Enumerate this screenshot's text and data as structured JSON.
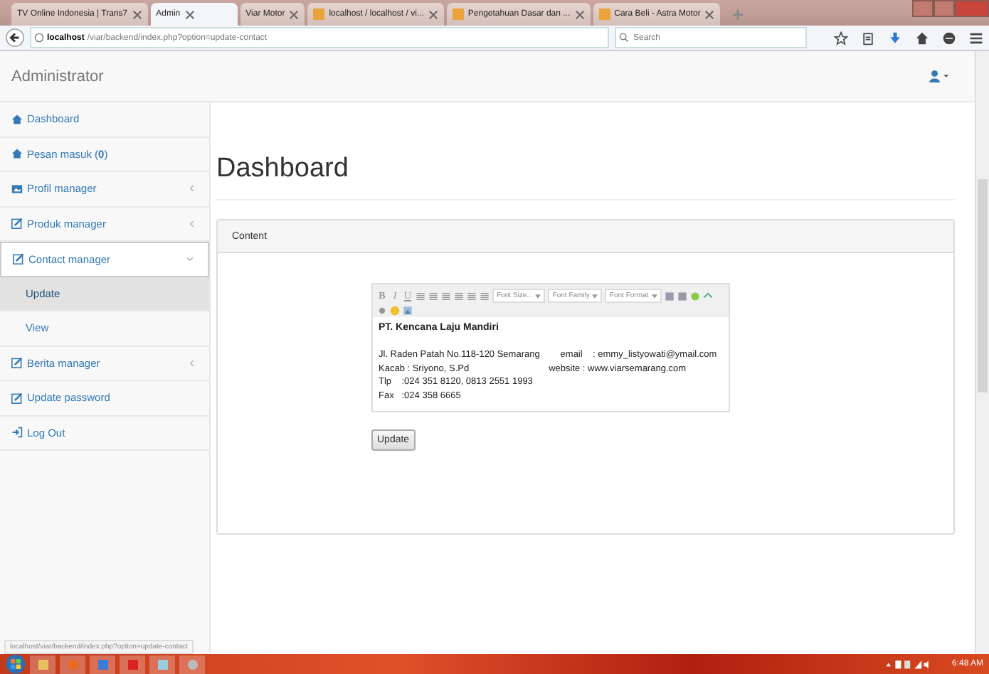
{
  "browser": {
    "tabs": [
      {
        "title": "TV Online Indonesia | Trans7",
        "selected": false,
        "favicon": false
      },
      {
        "title": "Admin",
        "selected": true,
        "favicon": false
      },
      {
        "title": "Viar Motor",
        "selected": false,
        "favicon": false
      },
      {
        "title": "localhost / localhost / vi...",
        "selected": false,
        "favicon": true
      },
      {
        "title": "Pengetahuan Dasar dan ...",
        "selected": false,
        "favicon": true
      },
      {
        "title": "Cara Beli - Astra Motor",
        "selected": false,
        "favicon": true
      }
    ],
    "url_host": "localhost",
    "url_path": "/viar/backend/index.php?option=update-contact",
    "search_placeholder": "Search",
    "status_url": "localhost/viar/backend/index.php?option=update-contact"
  },
  "navbar": {
    "brand": "Administrator"
  },
  "sidebar": [
    {
      "label": "Dashboard",
      "kind": "item",
      "selected": false
    },
    {
      "label": "Pesan masuk (**0**)",
      "kind": "item",
      "selected": false
    },
    {
      "label": "Profil manager",
      "kind": "menu",
      "expanded": false,
      "selected": false
    },
    {
      "label": "Produk manager",
      "kind": "menu",
      "expanded": false,
      "selected": false
    },
    {
      "label": "Contact manager",
      "kind": "menu",
      "expanded": true,
      "selected": true
    },
    {
      "label": "Update",
      "kind": "subitem",
      "selected": true
    },
    {
      "label": "View",
      "kind": "subitem",
      "selected": false
    },
    {
      "label": "Berita manager",
      "kind": "menu",
      "expanded": false,
      "selected": false
    },
    {
      "label": "Update password",
      "kind": "item",
      "selected": false
    },
    {
      "label": "Log Out",
      "kind": "item",
      "selected": false
    }
  ],
  "page": {
    "title": "Dashboard",
    "panel_title": "Content",
    "editor": {
      "format_buttons": [
        "B",
        "I",
        "U"
      ],
      "dropdowns": [
        "Font Size...",
        "Font Family",
        "Font Format"
      ],
      "heading": "PT. Kencana Laju Mandiri",
      "lines": [
        "Jl. Raden Patah No.118-120 Semarang        email    : emmy_listyowati@ymail.com",
        "Kacab : Sriyono, S.Pd                               website : www.viarsemarang.com",
        "Tlp    :024 351 8120, 0813 2551 1993",
        "Fax   :024 358 6665"
      ]
    },
    "button": "Update"
  },
  "taskbar": {
    "clock": "6:48 AM"
  }
}
